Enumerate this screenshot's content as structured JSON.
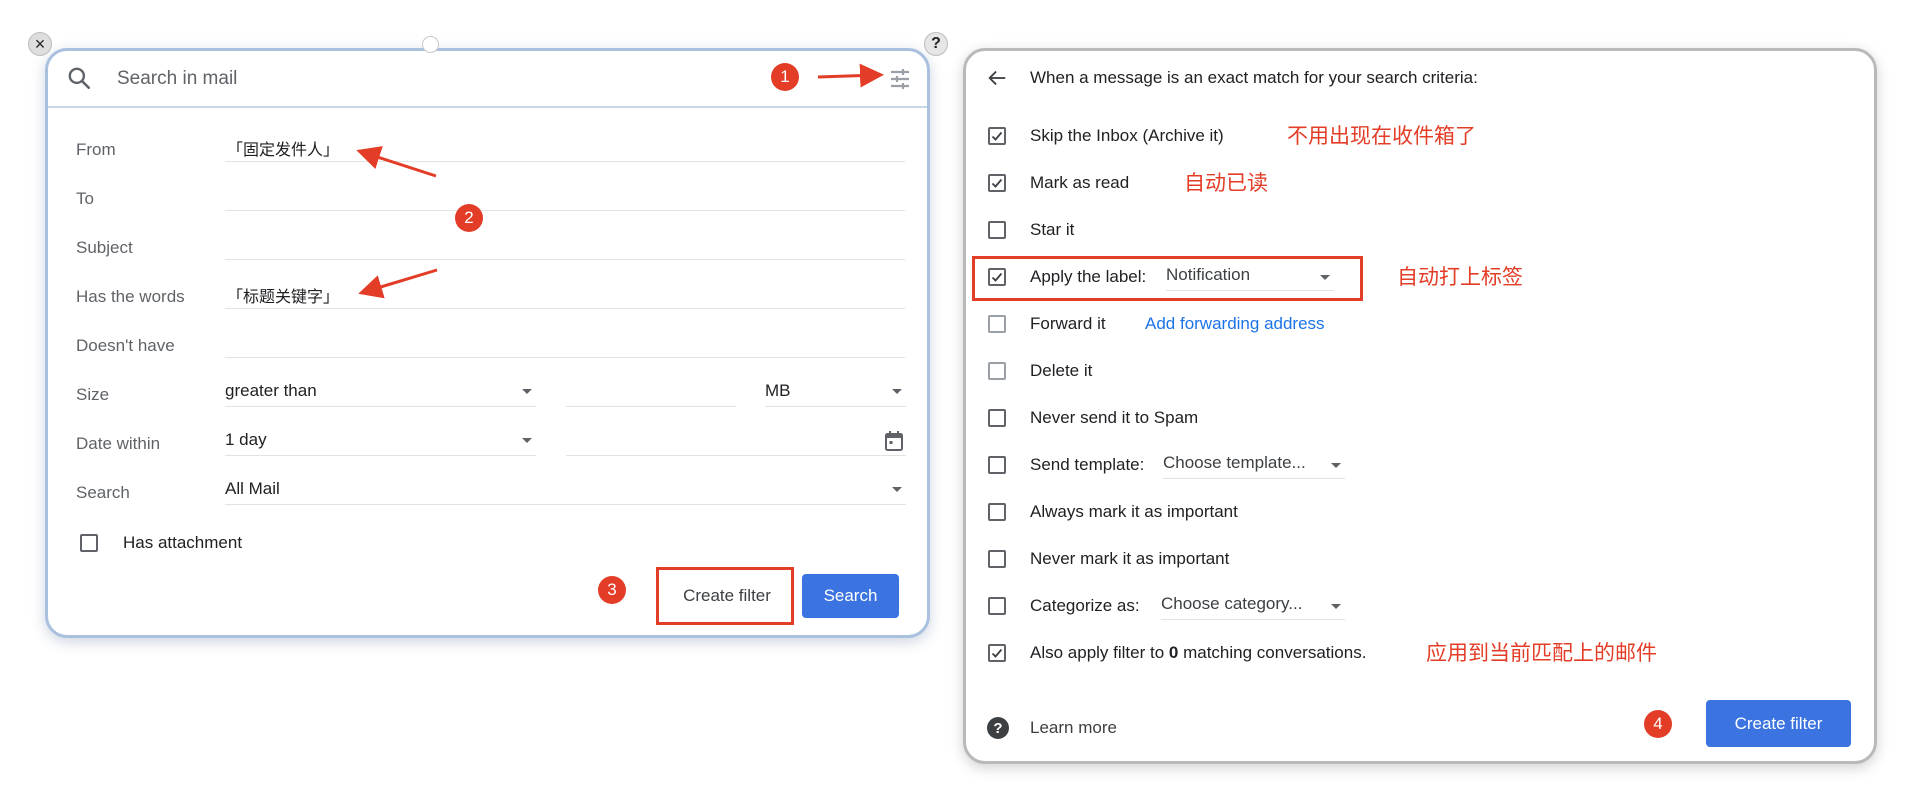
{
  "left_panel": {
    "close_icon": "×",
    "help_icon": "?",
    "search_placeholder": "Search in mail",
    "fields": [
      {
        "label": "From",
        "value": "「固定发件人」"
      },
      {
        "label": "To",
        "value": ""
      },
      {
        "label": "Subject",
        "value": ""
      },
      {
        "label": "Has the words",
        "value": "「标题关键字」"
      },
      {
        "label": "Doesn't have",
        "value": ""
      }
    ],
    "size": {
      "label": "Size",
      "operator": "greater than",
      "value": "",
      "unit": "MB"
    },
    "date_within": {
      "label": "Date within",
      "value": "1 day",
      "date": ""
    },
    "search_scope": {
      "label": "Search",
      "value": "All Mail"
    },
    "has_attachment": {
      "label": "Has attachment",
      "checked": false
    },
    "create_filter_label": "Create filter",
    "search_button_label": "Search"
  },
  "right_panel": {
    "header": "When a message is an exact match for your search criteria:",
    "actions": [
      {
        "label": "Skip the Inbox (Archive it)",
        "checked": true
      },
      {
        "label": "Mark as read",
        "checked": true
      },
      {
        "label": "Star it",
        "checked": false
      },
      {
        "label": "Apply the label:",
        "checked": true,
        "select_value": "Notification"
      },
      {
        "label": "Forward it",
        "checked": false,
        "disabled": true,
        "link": "Add forwarding address"
      },
      {
        "label": "Delete it",
        "checked": false,
        "disabled": true
      },
      {
        "label": "Never send it to Spam",
        "checked": false
      },
      {
        "label": "Send template:",
        "checked": false,
        "select_value": "Choose template..."
      },
      {
        "label": "Always mark it as important",
        "checked": false
      },
      {
        "label": "Never mark it as important",
        "checked": false
      },
      {
        "label": "Categorize as:",
        "checked": false,
        "select_value": "Choose category..."
      },
      {
        "label_prefix": "Also apply filter to ",
        "count": "0",
        "label_suffix": " matching conversations.",
        "checked": true
      }
    ],
    "learn_more": "Learn more",
    "create_filter_label": "Create filter"
  },
  "annotations": {
    "badges": [
      "1",
      "2",
      "3",
      "4"
    ],
    "notes": {
      "skip_inbox": "不用出现在收件箱了",
      "mark_read": "自动已读",
      "apply_label": "自动打上标签",
      "also_apply": "应用到当前匹配上的邮件"
    },
    "color": "#e33d27"
  },
  "colors": {
    "primary_button": "#3b73e0",
    "link": "#1a73e8"
  }
}
